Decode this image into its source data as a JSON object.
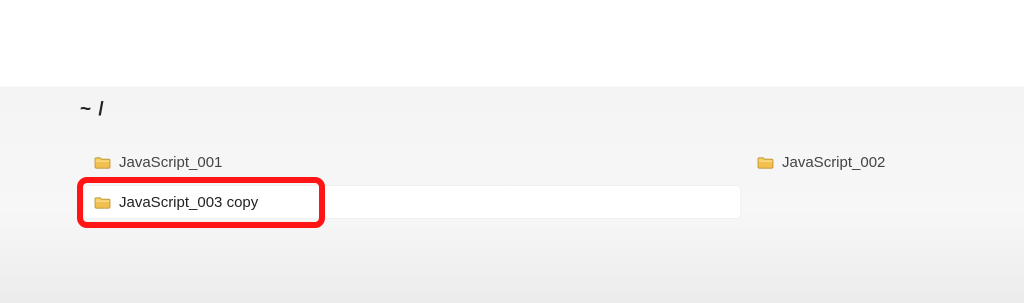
{
  "breadcrumb": {
    "path": "~ /"
  },
  "folders": [
    {
      "label": "JavaScript_001",
      "icon": "folder-icon"
    },
    {
      "label": "JavaScript_002",
      "icon": "folder-icon"
    },
    {
      "label": "JavaScript_003 copy",
      "icon": "folder-icon",
      "selected": true
    }
  ],
  "colors": {
    "highlight": "#ff1515",
    "folder": "#f2c04f"
  }
}
